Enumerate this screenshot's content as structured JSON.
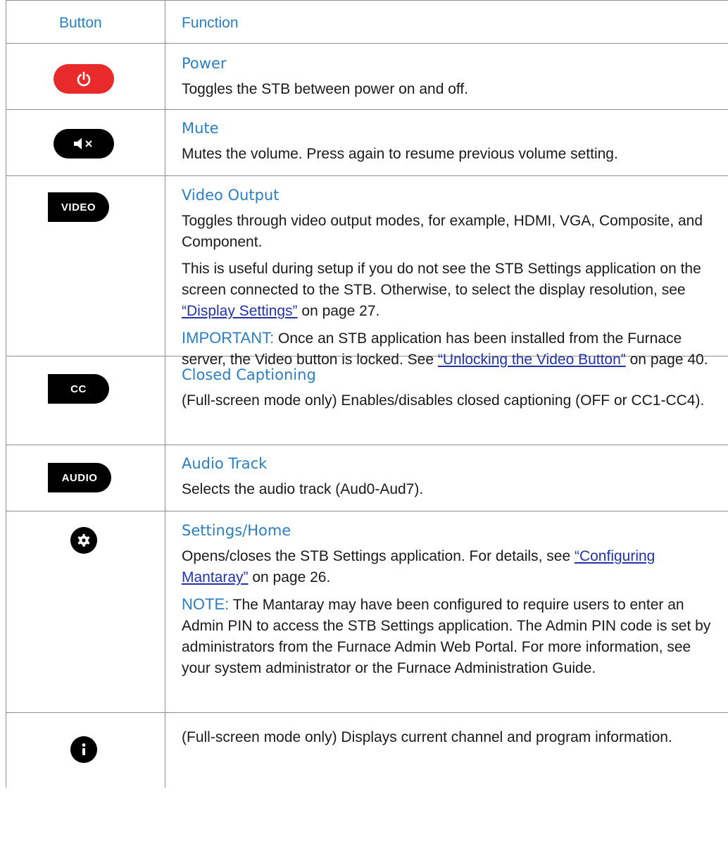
{
  "header": {
    "button": "Button",
    "function": "Function"
  },
  "colors": {
    "accent": "#2b7ec1",
    "power": "#e82a2a",
    "link": "#2233aa",
    "border": "#8e8e8e"
  },
  "rows": [
    {
      "icon": "power-icon",
      "title": "Power",
      "text": "Toggles the STB between power on and off."
    },
    {
      "icon": "mute-icon",
      "title": "Mute",
      "text": "Mutes the volume. Press again to resume previous volume setting."
    },
    {
      "icon_label": "VIDEO",
      "title": "Video Output",
      "p1": "Toggles through video output modes, for example, HDMI, VGA, Composite, and Component.",
      "p2_a": "This is useful during setup if you do not see the STB Settings application on the screen connected to the STB. Otherwise, to select the display resolution, see ",
      "p2_link": "“Display Settings”",
      "p2_b": " on page 27.",
      "p3_lead": "IMPORTANT:",
      "p3_a": " Once an STB application has been installed from the Furnace server, the Video button is locked. See ",
      "p3_link": "“Unlocking the Video Button”",
      "p3_b": " on page 40."
    },
    {
      "icon_label": "CC",
      "title": "Closed Captioning",
      "text": "(Full-screen mode only) Enables/disables closed captioning (OFF or CC1-CC4)."
    },
    {
      "icon_label": "AUDIO",
      "title": "Audio Track",
      "text": "Selects the audio track (Aud0-Aud7)."
    },
    {
      "icon": "gear-icon",
      "title": "Settings/Home",
      "p1_a": "Opens/closes the STB Settings application. For details, see ",
      "p1_link": "“Configuring Mantaray”",
      "p1_b": " on page 26.",
      "p2_lead": "NOTE:",
      "p2_a": " The Mantaray may have been configured to require users to enter an Admin PIN to access the STB Settings application. The Admin PIN code is set by administrators from the Furnace Admin Web Portal. For more information, see your system administrator or the Furnace Administration Guide."
    },
    {
      "icon": "info-icon",
      "text": "(Full-screen mode only) Displays current channel and program information."
    }
  ]
}
